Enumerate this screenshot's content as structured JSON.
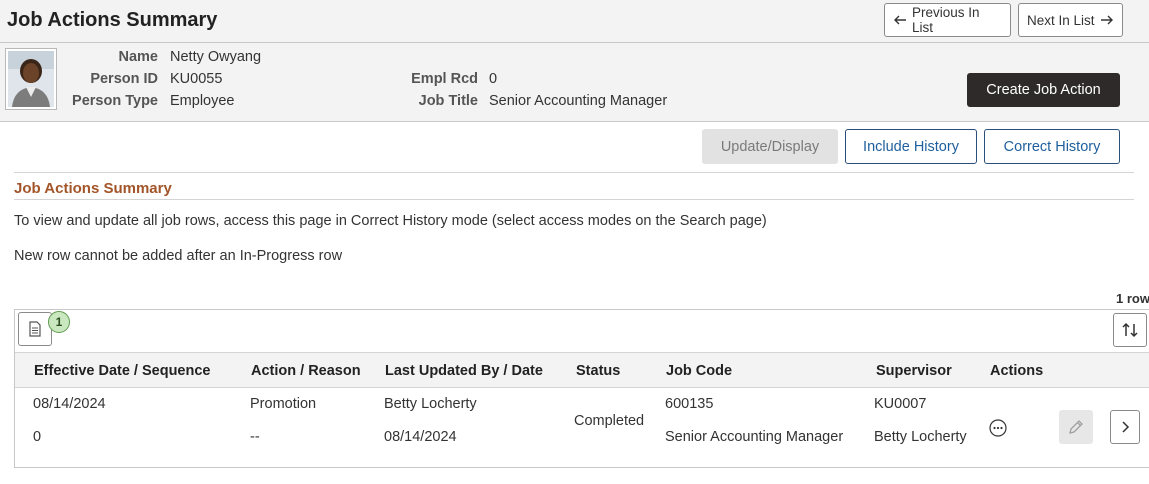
{
  "page": {
    "title": "Job Actions Summary",
    "prev_label": "Previous In List",
    "next_label": "Next In List"
  },
  "person": {
    "name_label": "Name",
    "name": "Netty Owyang",
    "id_label": "Person ID",
    "id": "KU0055",
    "type_label": "Person Type",
    "type": "Employee",
    "empl_rcd_label": "Empl Rcd",
    "empl_rcd": "0",
    "job_title_label": "Job Title",
    "job_title": "Senior Accounting Manager"
  },
  "actions": {
    "create_label": "Create Job Action",
    "update_display_label": "Update/Display",
    "include_history_label": "Include History",
    "correct_history_label": "Correct History"
  },
  "section": {
    "title": "Job Actions Summary",
    "info_line_1": "To view and update all job rows, access this page in Correct History mode (select access modes on the Search page)",
    "info_line_2": "New row cannot be added after an In-Progress row"
  },
  "grid": {
    "row_count": "1 row",
    "badge_count": "1",
    "columns": [
      "Effective Date / Sequence",
      "Action / Reason",
      "Last Updated By / Date",
      "Status",
      "Job Code",
      "Supervisor",
      "Actions"
    ],
    "rows": [
      {
        "effective_date": "08/14/2024",
        "sequence": "0",
        "action": "Promotion",
        "reason": "--",
        "updated_by": "Betty Locherty",
        "updated_date": "08/14/2024",
        "status": "Completed",
        "job_code": "600135",
        "job_code_descr": "Senior Accounting Manager",
        "supervisor_id": "KU0007",
        "supervisor_name": "Betty Locherty"
      }
    ]
  },
  "colors": {
    "accent_text": "#1f5f9d",
    "section_title": "#a3552a",
    "dark_button": "#2d2a29",
    "badge_bg": "#c9e8bf"
  },
  "icons": {
    "prev": "arrow-left-icon",
    "next": "arrow-right-icon",
    "page": "document-icon",
    "sort": "sort-icon",
    "row_actions": "ellipsis-icon",
    "edit": "pencil-icon",
    "detail": "chevron-right-icon"
  }
}
